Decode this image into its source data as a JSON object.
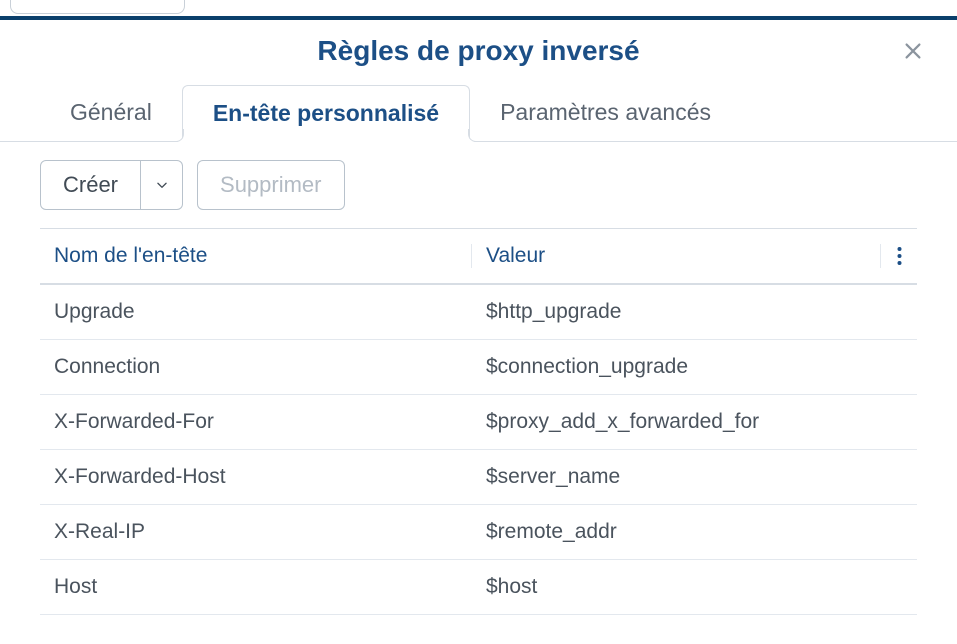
{
  "dialog": {
    "title": "Règles de proxy inversé"
  },
  "tabs": {
    "general": "Général",
    "custom_header": "En-tête personnalisé",
    "advanced": "Paramètres avancés"
  },
  "toolbar": {
    "create": "Créer",
    "delete": "Supprimer"
  },
  "table": {
    "col_name": "Nom de l'en-tête",
    "col_value": "Valeur",
    "rows": [
      {
        "name": "Upgrade",
        "value": "$http_upgrade"
      },
      {
        "name": "Connection",
        "value": "$connection_upgrade"
      },
      {
        "name": "X-Forwarded-For",
        "value": "$proxy_add_x_forwarded_for"
      },
      {
        "name": "X-Forwarded-Host",
        "value": "$server_name"
      },
      {
        "name": "X-Real-IP",
        "value": "$remote_addr"
      },
      {
        "name": "Host",
        "value": "$host"
      }
    ]
  }
}
